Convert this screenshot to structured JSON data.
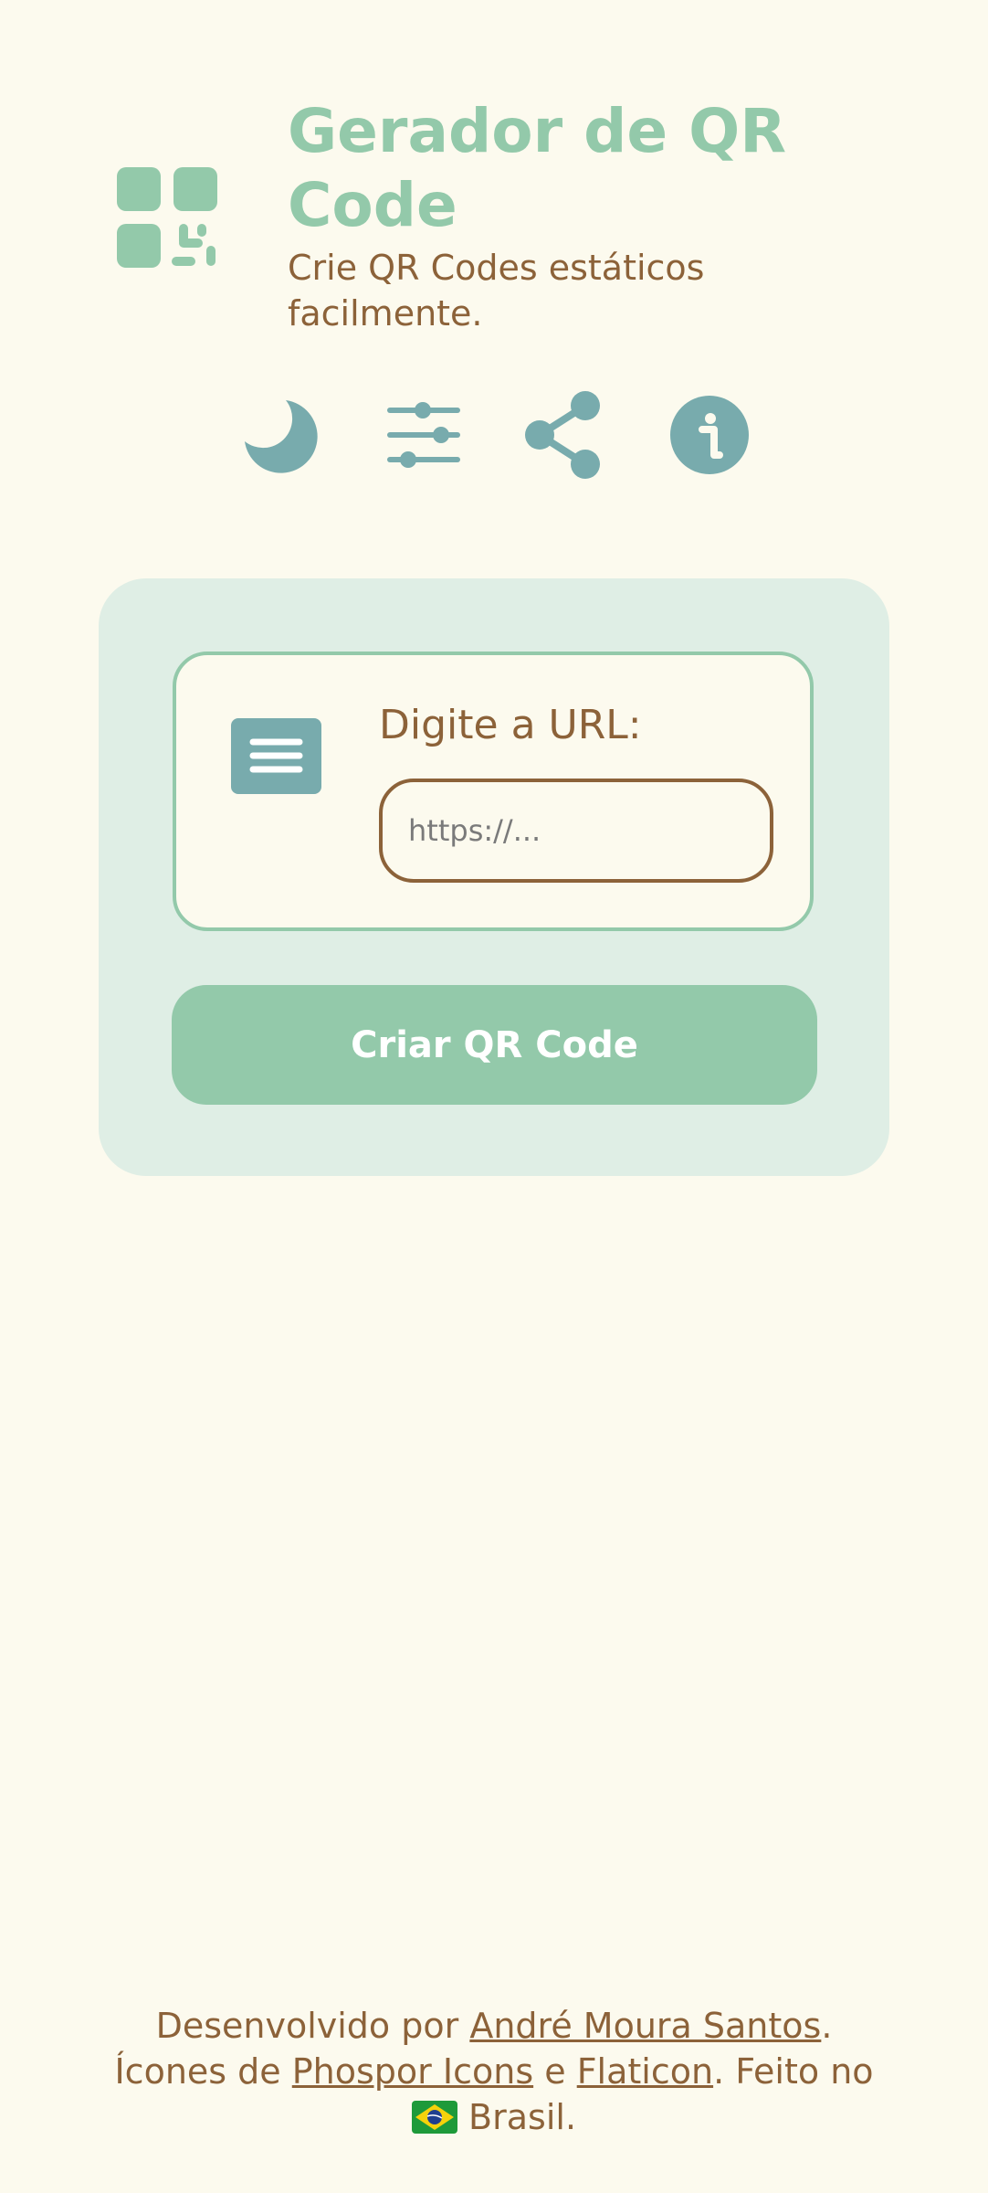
{
  "header": {
    "logo_icon": "qr-code-icon",
    "title": "Gerador de QR Code",
    "subtitle": "Crie QR Codes estáticos facilmente."
  },
  "toolbar": {
    "buttons": [
      {
        "icon": "moon-icon",
        "action": "toggle-dark-mode"
      },
      {
        "icon": "sliders-icon",
        "action": "settings"
      },
      {
        "icon": "share-icon",
        "action": "share"
      },
      {
        "icon": "info-icon",
        "action": "info"
      }
    ]
  },
  "form": {
    "field_icon": "text-lines-icon",
    "label": "Digite a URL:",
    "url_value": "",
    "url_placeholder": "https://...",
    "submit_label": "Criar QR Code"
  },
  "footer": {
    "developed_by": "Desenvolvido por",
    "author": "André Moura Santos",
    "period": ".",
    "icons_from": "Ícones de",
    "icons_source_1": "Phospor Icons",
    "and": "e",
    "icons_source_2": "Flaticon",
    "made_in": ". Feito no",
    "flag_icon": "brazil-flag-icon",
    "country": "Brasil."
  },
  "colors": {
    "background": "#fcfaee",
    "accent_green": "#93c9aa",
    "card_bg": "#dfeee5",
    "icon_teal": "#78abad",
    "text_brown": "#8c6239"
  }
}
